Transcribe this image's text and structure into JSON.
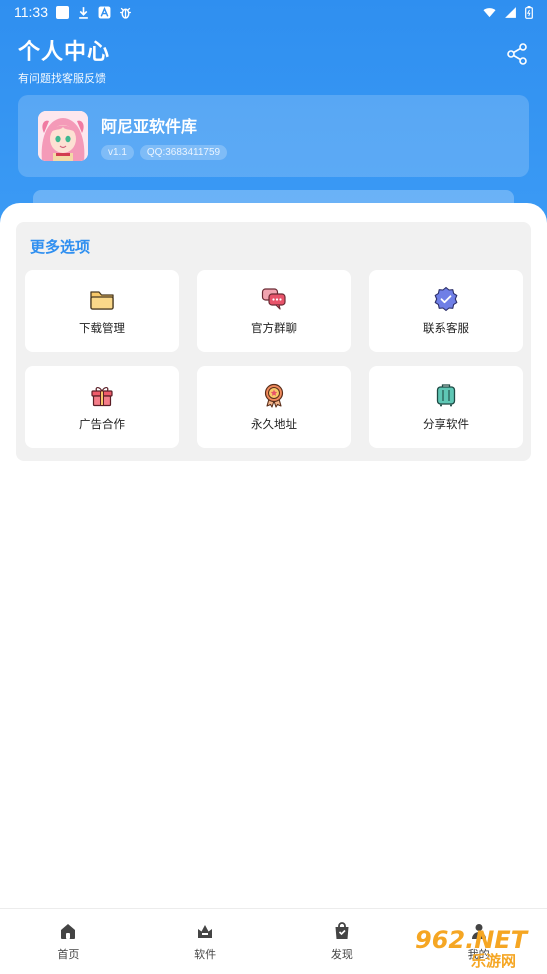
{
  "status_bar": {
    "time": "11:33",
    "icons": [
      "square-icon",
      "download-icon",
      "a-icon",
      "bug-icon",
      "wifi-icon",
      "signal-icon",
      "battery-icon"
    ]
  },
  "header": {
    "title": "个人中心",
    "subtitle": "有问题找客服反馈",
    "share_icon": "share-icon"
  },
  "profile": {
    "app_name": "阿尼亚软件库",
    "version": "v1.1",
    "qq": "QQ:3683411759"
  },
  "options": {
    "title": "更多选项",
    "items": [
      {
        "label": "下载管理",
        "icon": "folder-icon"
      },
      {
        "label": "官方群聊",
        "icon": "chat-icon"
      },
      {
        "label": "联系客服",
        "icon": "verified-badge-icon"
      },
      {
        "label": "广告合作",
        "icon": "gift-icon"
      },
      {
        "label": "永久地址",
        "icon": "award-medal-icon"
      },
      {
        "label": "分享软件",
        "icon": "suitcase-icon"
      }
    ]
  },
  "bottom_nav": {
    "items": [
      {
        "label": "首页",
        "icon": "home-icon"
      },
      {
        "label": "软件",
        "icon": "crown-icon"
      },
      {
        "label": "发现",
        "icon": "shopping-bag-icon"
      },
      {
        "label": "我的",
        "icon": "person-icon"
      }
    ]
  },
  "watermark": {
    "main": "962.NET",
    "sub": "乐游网"
  },
  "colors": {
    "accent": "#2f8ff0",
    "panel_bg": "#f1f1f1",
    "watermark": "#f5a623"
  }
}
